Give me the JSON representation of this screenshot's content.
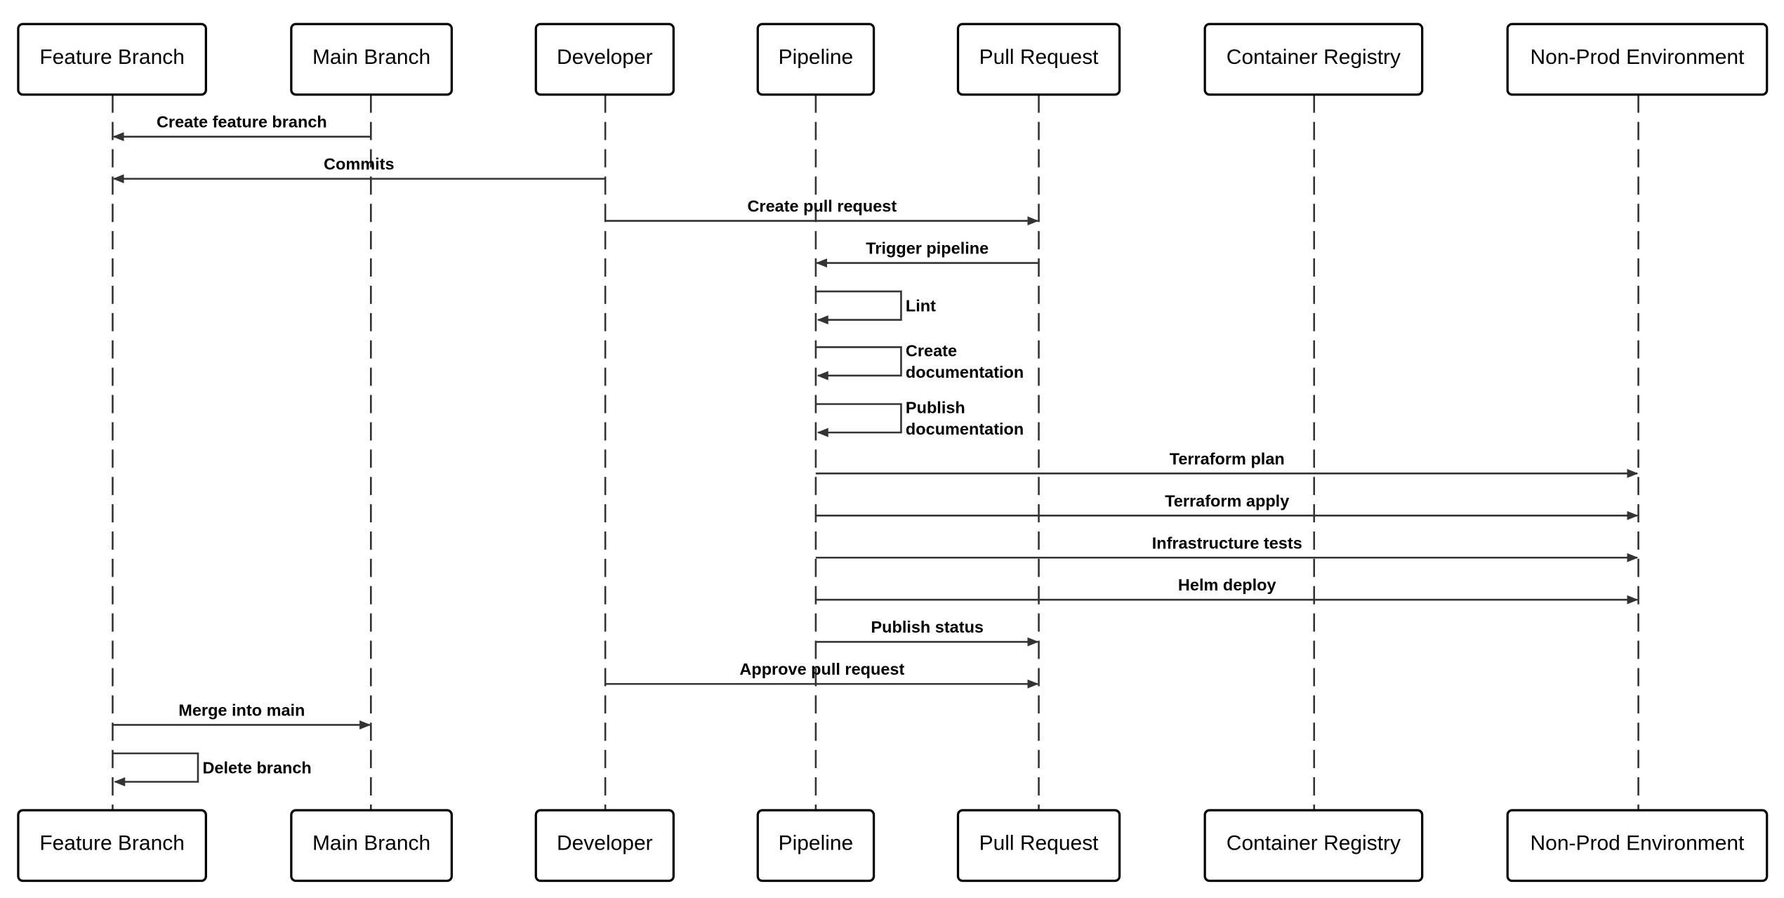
{
  "participants": [
    "Feature Branch",
    "Main Branch",
    "Developer",
    "Pipeline",
    "Pull Request",
    "Container Registry",
    "Non-Prod Environment"
  ],
  "messages": [
    {
      "from": 1,
      "to": 0,
      "label": [
        "Create feature branch"
      ]
    },
    {
      "from": 2,
      "to": 0,
      "label": [
        "Commits"
      ]
    },
    {
      "from": 2,
      "to": 4,
      "label": [
        "Create pull request"
      ]
    },
    {
      "from": 4,
      "to": 3,
      "label": [
        "Trigger pipeline"
      ]
    },
    {
      "from": 3,
      "to": 3,
      "label": [
        "Lint"
      ]
    },
    {
      "from": 3,
      "to": 3,
      "label": [
        "Create",
        "documentation"
      ]
    },
    {
      "from": 3,
      "to": 3,
      "label": [
        "Publish",
        "documentation"
      ]
    },
    {
      "from": 3,
      "to": 6,
      "label": [
        "Terraform plan"
      ]
    },
    {
      "from": 3,
      "to": 6,
      "label": [
        "Terraform apply"
      ]
    },
    {
      "from": 3,
      "to": 6,
      "label": [
        "Infrastructure tests"
      ]
    },
    {
      "from": 3,
      "to": 6,
      "label": [
        "Helm deploy"
      ]
    },
    {
      "from": 3,
      "to": 4,
      "label": [
        "Publish status"
      ]
    },
    {
      "from": 2,
      "to": 4,
      "label": [
        "Approve pull request"
      ]
    },
    {
      "from": 0,
      "to": 1,
      "label": [
        "Merge into main"
      ]
    },
    {
      "from": 0,
      "to": 0,
      "label": [
        "Delete branch"
      ]
    }
  ],
  "colors": {
    "line": "#333333",
    "text": "#000000",
    "background": "#ffffff"
  }
}
